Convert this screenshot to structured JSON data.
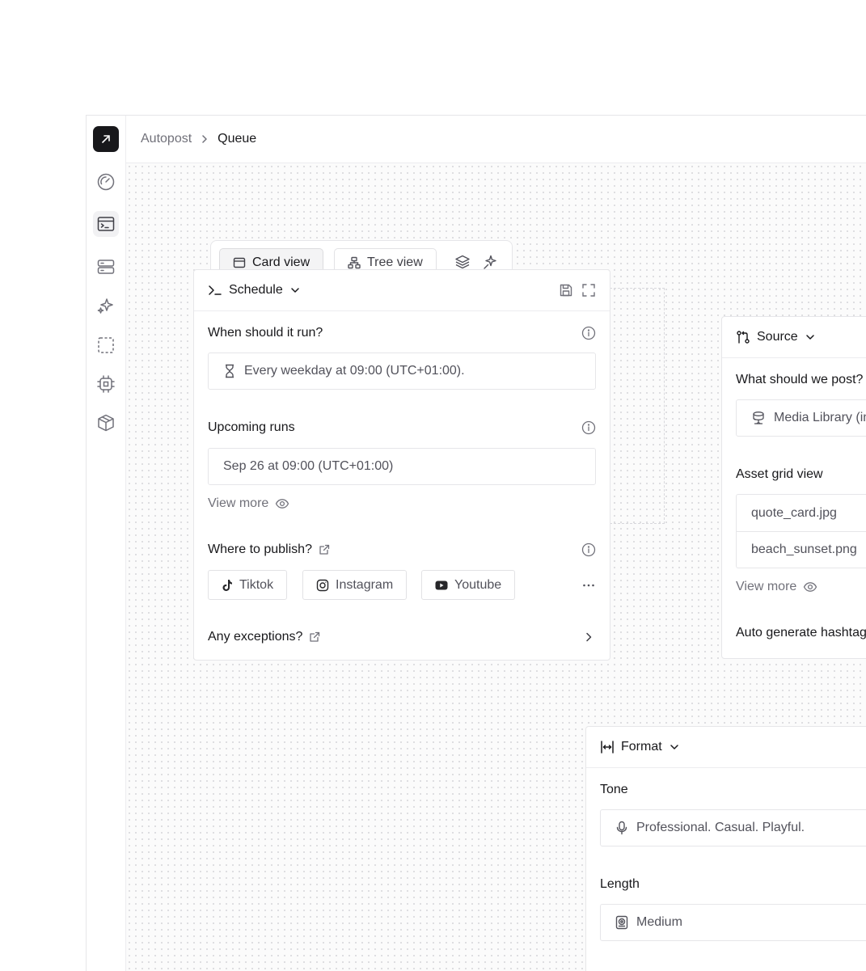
{
  "breadcrumb": {
    "parent": "Autopost",
    "current": "Queue"
  },
  "sidebar": {
    "icons": [
      "arrow-up-right-icon",
      "gauge-icon",
      "terminal-window-icon",
      "server-icon",
      "sparkles-icon",
      "scan-icon",
      "cpu-icon",
      "package-icon"
    ],
    "active_index": 2
  },
  "toolbar": {
    "card_view": "Card view",
    "tree_view": "Tree view"
  },
  "schedule_card": {
    "title": "Schedule",
    "when_label": "When should it run?",
    "when_value": "Every weekday at 09:00 (UTC+01:00).",
    "upcoming_label": "Upcoming runs",
    "upcoming_value": "Sep 26 at 09:00 (UTC+01:00)",
    "view_more": "View more",
    "publish_label": "Where to publish?",
    "platforms": [
      "Tiktok",
      "Instagram",
      "Youtube"
    ],
    "exceptions_label": "Any exceptions?"
  },
  "source_card": {
    "title": "Source",
    "question": "What should we post?",
    "library_value": "Media Library (images)",
    "grid_label": "Asset grid view",
    "assets": [
      "quote_card.jpg",
      "beach_sunset.png"
    ],
    "view_more": "View more",
    "hashtags_label": "Auto generate hashtags"
  },
  "format_card": {
    "title": "Format",
    "tone_label": "Tone",
    "tone_value": "Professional. Casual. Playful.",
    "length_label": "Length",
    "length_value": "Medium"
  },
  "colors": {
    "accent_dark": "#18181b",
    "border": "#e6e6e9",
    "muted_text": "#71717a"
  }
}
